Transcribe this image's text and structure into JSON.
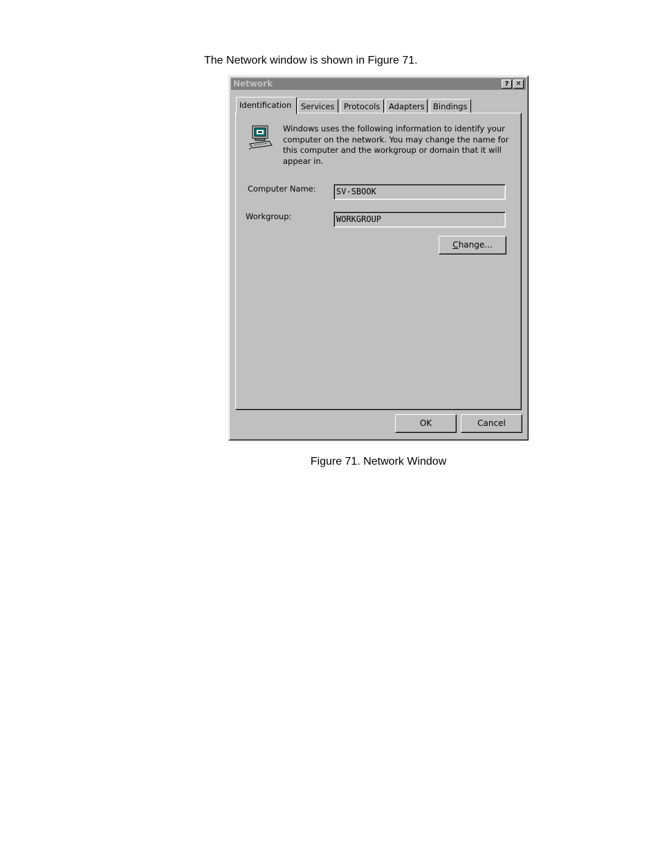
{
  "intro_text": "The Network window is shown in Figure 71.",
  "caption": "Figure 71. Network Window",
  "window": {
    "title": "Network",
    "help_button": "?",
    "close_button": "✕",
    "tabs": [
      {
        "label": "Identification",
        "active": true
      },
      {
        "label": "Services"
      },
      {
        "label": "Protocols"
      },
      {
        "label": "Adapters"
      },
      {
        "label": "Bindings"
      }
    ],
    "icon": "computer-network-icon",
    "info_text": "Windows uses the following information to identify your computer on the network.  You may change the name for this computer and the workgroup or domain that it will appear in.",
    "computer_name_label": "Computer Name:",
    "computer_name_value": "SV-SBOOK",
    "workgroup_label": "Workgroup:",
    "workgroup_value": "WORKGROUP",
    "change_button": {
      "mnemonic": "C",
      "rest": "hange..."
    },
    "ok_button": "OK",
    "cancel_button": "Cancel"
  }
}
